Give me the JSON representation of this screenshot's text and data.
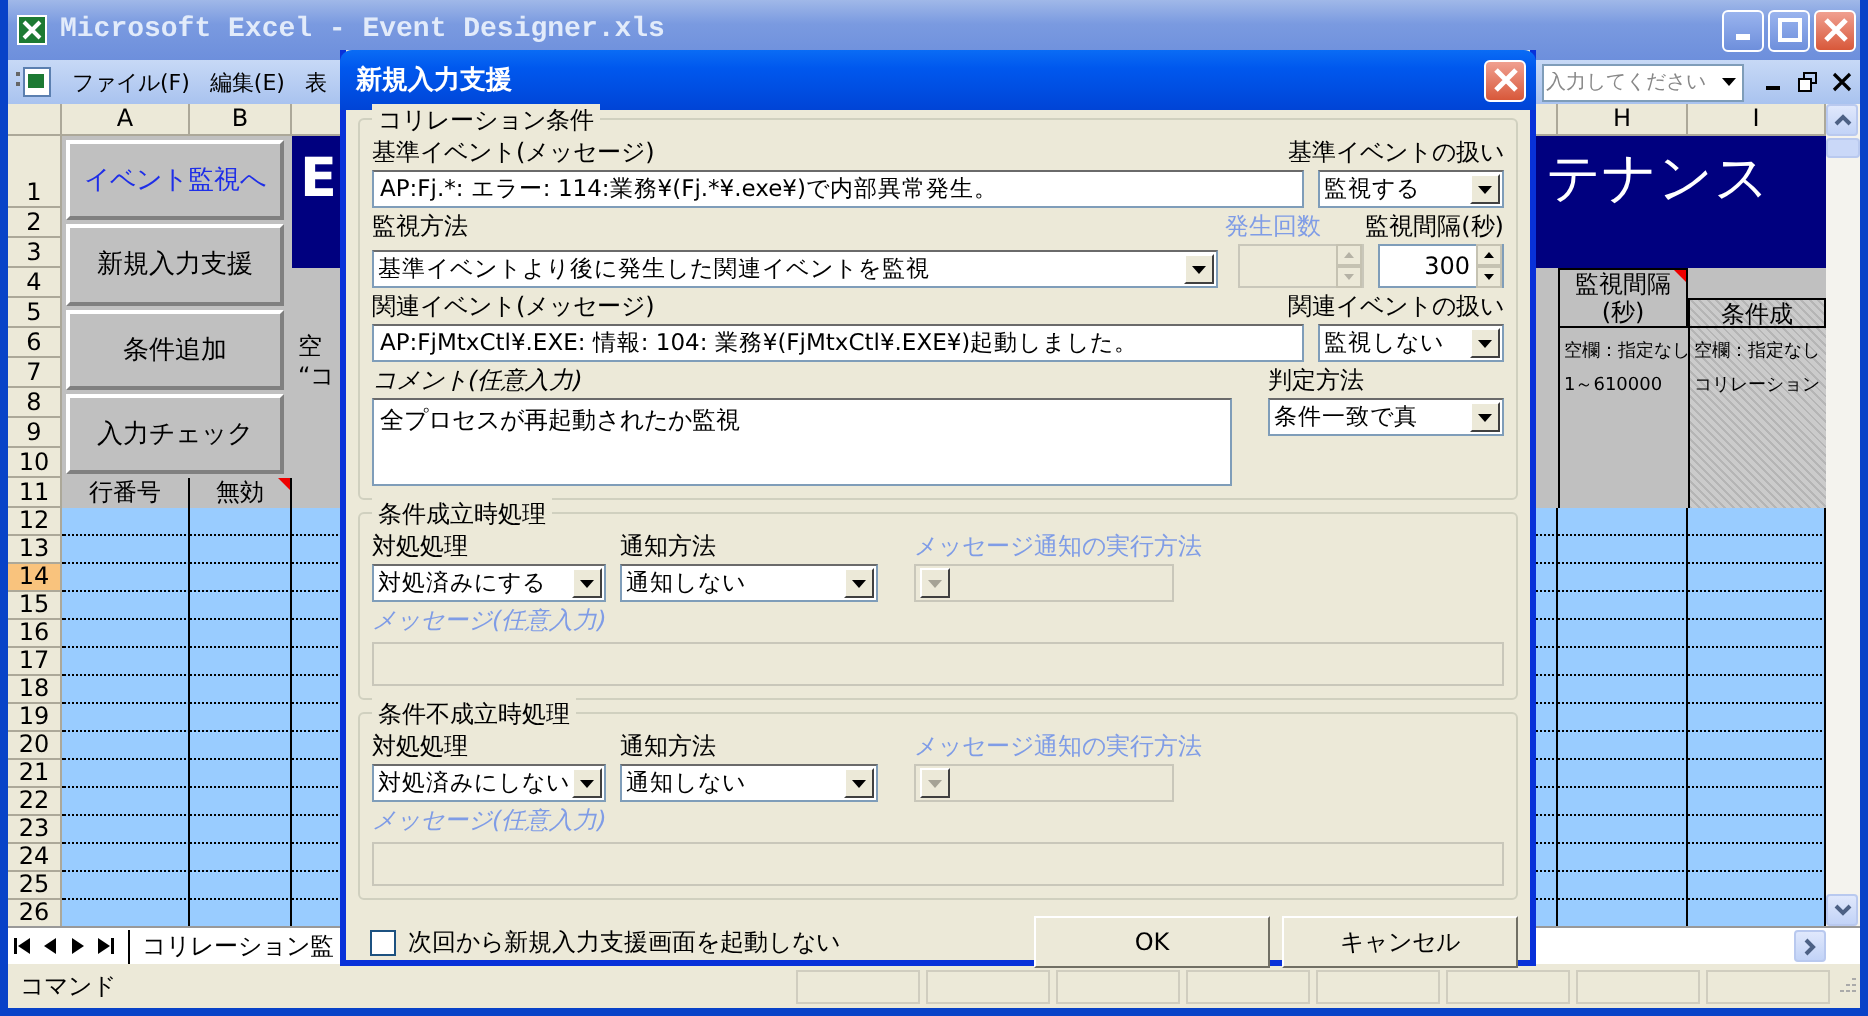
{
  "excel": {
    "title": "Microsoft Excel - Event Designer.xls",
    "menu": [
      {
        "label": "ファイル(F)"
      },
      {
        "label": "編集(E)"
      },
      {
        "label": "表"
      }
    ],
    "help_box": {
      "placeholder": "入力してください"
    },
    "columns": [
      {
        "label": "A"
      },
      {
        "label": "B"
      },
      {
        "label": "H"
      },
      {
        "label": "I"
      }
    ],
    "rows": [
      {
        "label": "1",
        "selected": false
      },
      {
        "label": "2",
        "selected": false
      },
      {
        "label": "3",
        "selected": false
      },
      {
        "label": "4",
        "selected": false
      },
      {
        "label": "5",
        "selected": false
      },
      {
        "label": "6",
        "selected": false
      },
      {
        "label": "7",
        "selected": false
      },
      {
        "label": "8",
        "selected": false
      },
      {
        "label": "9",
        "selected": false
      },
      {
        "label": "10",
        "selected": false
      },
      {
        "label": "11",
        "selected": false
      },
      {
        "label": "12",
        "selected": false
      },
      {
        "label": "13",
        "selected": false
      },
      {
        "label": "14",
        "selected": true
      },
      {
        "label": "15",
        "selected": false
      },
      {
        "label": "16",
        "selected": false
      },
      {
        "label": "17",
        "selected": false
      },
      {
        "label": "18",
        "selected": false
      },
      {
        "label": "19",
        "selected": false
      },
      {
        "label": "20",
        "selected": false
      },
      {
        "label": "21",
        "selected": false
      },
      {
        "label": "22",
        "selected": false
      },
      {
        "label": "23",
        "selected": false
      },
      {
        "label": "24",
        "selected": false
      },
      {
        "label": "25",
        "selected": false
      },
      {
        "label": "26",
        "selected": false
      }
    ],
    "sheet_buttons": [
      {
        "label": "イベント監視へ",
        "kind": "link"
      },
      {
        "label": "新規入力支援",
        "kind": "command"
      },
      {
        "label": "条件追加",
        "kind": "command"
      },
      {
        "label": "入力チェック",
        "kind": "command"
      }
    ],
    "banner": {
      "left": "E",
      "right": "テナンス"
    },
    "list_headers": [
      {
        "label": "行番号"
      },
      {
        "label": "無効"
      }
    ],
    "partial_note": [
      "空",
      "“コ"
    ],
    "interval_header": [
      "監視間隔",
      "(秒)"
    ],
    "interval_note": [
      "空欄：指定なし",
      "1～610000"
    ],
    "condition_header": "条件成",
    "condition_note": [
      "空欄：指定なし",
      "コリレーション"
    ],
    "sheet_tab": "コリレーション監",
    "status": "コマンド"
  },
  "dialog": {
    "title": "新規入力支援",
    "correlation": {
      "legend": "コリレーション条件",
      "base_event": {
        "label": "基準イベント(メッセージ)",
        "value": "AP:Fj.*: エラー: 114:業務¥(Fj.*¥.exe¥)で内部異常発生。"
      },
      "base_handling": {
        "label": "基準イベントの扱い",
        "value": "監視する"
      },
      "method": {
        "label": "監視方法",
        "value": "基準イベントより後に発生した関連イベントを監視"
      },
      "count": {
        "label": "発生回数",
        "disabled": true
      },
      "interval": {
        "label": "監視間隔(秒)",
        "value": "300",
        "disabled": false
      },
      "related_event": {
        "label": "関連イベント(メッセージ)",
        "value": "AP:FjMtxCtl¥.EXE: 情報: 104: 業務¥(FjMtxCtl¥.EXE¥)起動しました。"
      },
      "related_handling": {
        "label": "関連イベントの扱い",
        "value": "監視しない"
      },
      "comment": {
        "label": "コメント(任意入力)",
        "value": "全プロセスが再起動されたか監視"
      },
      "judgement": {
        "label": "判定方法",
        "value": "条件一致で真"
      }
    },
    "outcomes": [
      {
        "legend": "条件成立時処理",
        "action": {
          "label": "対処処理",
          "value": "対処済みにする"
        },
        "notify": {
          "label": "通知方法",
          "value": "通知しない"
        },
        "exec": {
          "label": "メッセージ通知の実行方法",
          "disabled": true
        },
        "message": {
          "label": "メッセージ(任意入力)",
          "disabled": true
        }
      },
      {
        "legend": "条件不成立時処理",
        "action": {
          "label": "対処処理",
          "value": "対処済みにしない"
        },
        "notify": {
          "label": "通知方法",
          "value": "通知しない"
        },
        "exec": {
          "label": "メッセージ通知の実行方法",
          "disabled": true
        },
        "message": {
          "label": "メッセージ(任意入力)",
          "disabled": true
        }
      }
    ],
    "dont_show": {
      "label": "次回から新規入力支援画面を起動しない",
      "checked": false
    },
    "buttons": [
      {
        "label": "OK"
      },
      {
        "label": "キャンセル"
      }
    ]
  }
}
